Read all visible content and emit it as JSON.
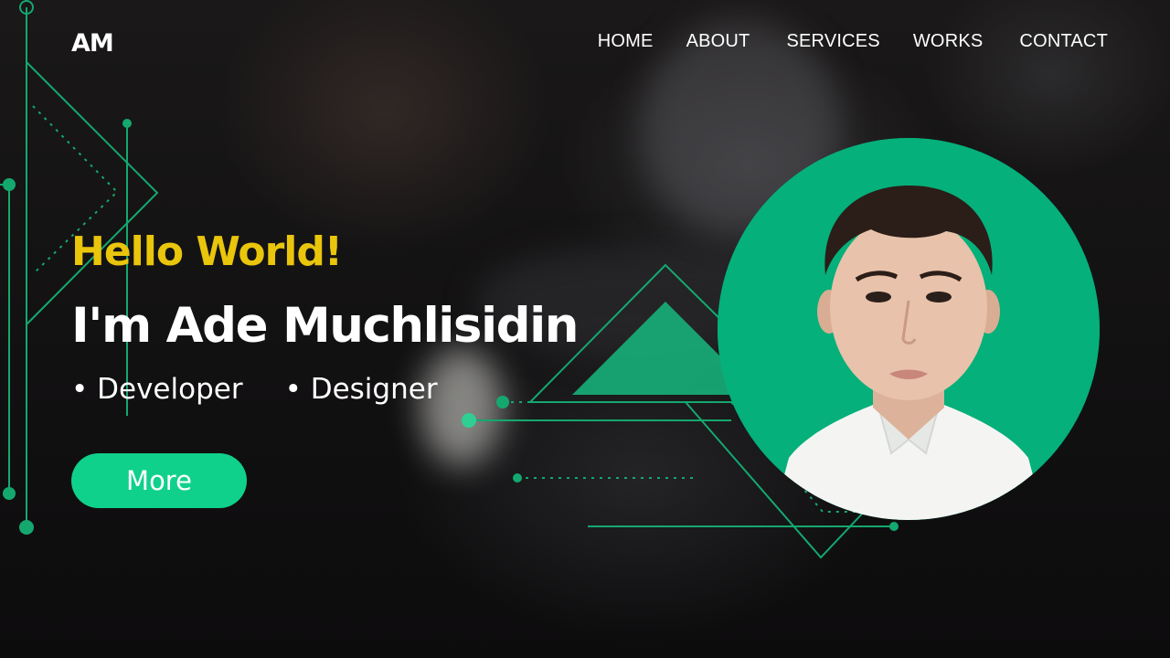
{
  "logo": {
    "text": "AM"
  },
  "nav": {
    "items": [
      {
        "label": "HOME"
      },
      {
        "label": "ABOUT"
      },
      {
        "label": "SERVICES"
      },
      {
        "label": "WORKS"
      },
      {
        "label": "CONTACT"
      }
    ]
  },
  "hero": {
    "greeting": "Hello World!",
    "name": "I'm Ade Muchlisidin",
    "roles": [
      "• Developer",
      "• Designer"
    ],
    "button_label": "More"
  },
  "colors": {
    "accent": "#0fd18c",
    "greeting": "#e9c50c",
    "avatar_bg": "#05b07a",
    "line": "#14a86f"
  },
  "icons": {
    "profile": "profile-photo"
  }
}
